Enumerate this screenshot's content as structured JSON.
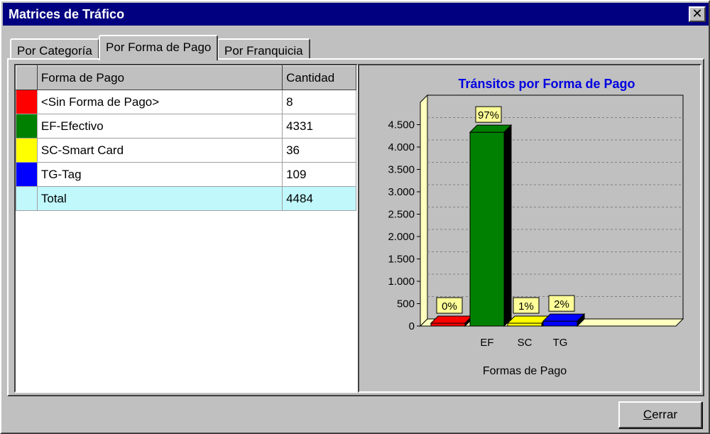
{
  "window": {
    "title": "Matrices de Tráfico",
    "close_glyph": "✕"
  },
  "tabs": [
    {
      "label": "Por Categoría",
      "active": false
    },
    {
      "label": "Por Forma de Pago",
      "active": true
    },
    {
      "label": "Por Franquicia",
      "active": false
    }
  ],
  "grid": {
    "headers": [
      "Forma de Pago",
      "Cantidad"
    ],
    "rows": [
      {
        "color": "#ff0000",
        "label": "<Sin Forma de Pago>",
        "value": "8"
      },
      {
        "color": "#008000",
        "label": "EF-Efectivo",
        "value": "4331"
      },
      {
        "color": "#ffff00",
        "label": "SC-Smart Card",
        "value": "36"
      },
      {
        "color": "#0000ff",
        "label": "TG-Tag",
        "value": "109"
      }
    ],
    "total": {
      "label": "Total",
      "value": "4484",
      "color": "#c0f8fc"
    }
  },
  "chart_data": {
    "type": "bar",
    "title": "Tránsitos por Forma de Pago",
    "xlabel": "Formas de Pago",
    "ylabel": "",
    "ylim": [
      0,
      5000
    ],
    "yticks": [
      0,
      500,
      1000,
      1500,
      2000,
      2500,
      3000,
      3500,
      4000,
      4500
    ],
    "ytick_labels": [
      "0",
      "500",
      "1.000",
      "1.500",
      "2.000",
      "2.500",
      "3.000",
      "3.500",
      "4.000",
      "4.500"
    ],
    "categories": [
      "",
      "EF",
      "SC",
      "TG"
    ],
    "values": [
      8,
      4331,
      36,
      109
    ],
    "data_labels": [
      "0%",
      "97%",
      "1%",
      "2%"
    ],
    "colors": [
      "#ff0000",
      "#008000",
      "#ffff00",
      "#0000ff"
    ],
    "grid": true,
    "three_d": true
  },
  "buttons": {
    "close_prefix": "C",
    "close_rest": "errar"
  }
}
